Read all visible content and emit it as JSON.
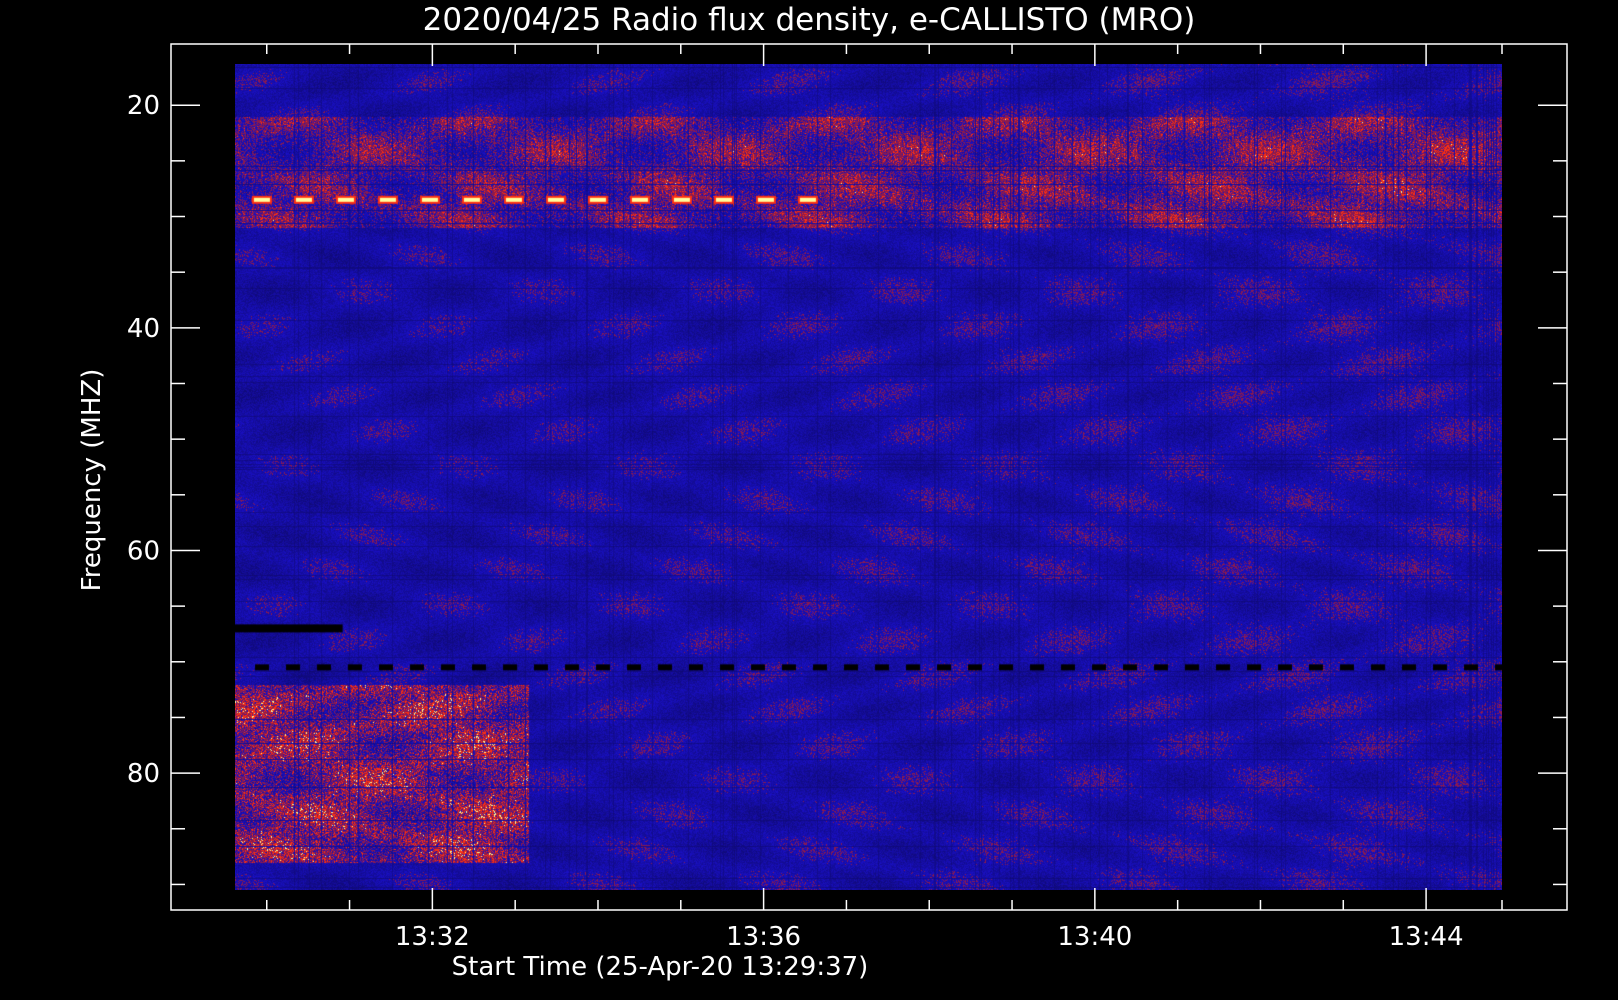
{
  "chart_data": {
    "type": "heatmap",
    "title": "2020/04/25  Radio flux density, e-CALLISTO (MRO)",
    "xlabel": "Start Time (25-Apr-20 13:29:37)",
    "ylabel": "Frequency (MHZ)",
    "x_ticks": [
      "13:32",
      "13:36",
      "13:40",
      "13:44"
    ],
    "y_ticks": [
      "20",
      "40",
      "60",
      "80"
    ],
    "xlim": [
      "13:29:37",
      "13:44:55"
    ],
    "ylim": [
      90.5,
      16.3
    ],
    "y_inverted": true,
    "colors": {
      "background": "#000000",
      "low": "#1a10c8",
      "mid": "#8a1a50",
      "high": "#ff3010",
      "peak": "#ffffa0"
    },
    "features": [
      {
        "kind": "intermittent-strong-signal",
        "freq_mhz": 28.5,
        "time_start": "13:29:50",
        "time_end": "13:36:30",
        "level": "peak"
      },
      {
        "kind": "dropout-line",
        "freq_mhz": 67.0,
        "time_start": "13:29:37",
        "time_end": "13:30:55"
      },
      {
        "kind": "dashed-dropout-line",
        "freq_mhz": 70.5,
        "time_start": "13:29:37",
        "time_end": "13:44:55"
      },
      {
        "kind": "emission-band",
        "freq_mhz_range": [
          21,
          31
        ],
        "time_start": "13:29:37",
        "time_end": "13:44:55",
        "level": "mid"
      },
      {
        "kind": "emission-region",
        "freq_mhz_range": [
          72,
          88
        ],
        "time_start": "13:29:37",
        "time_end": "13:33:10",
        "level": "high"
      }
    ]
  }
}
